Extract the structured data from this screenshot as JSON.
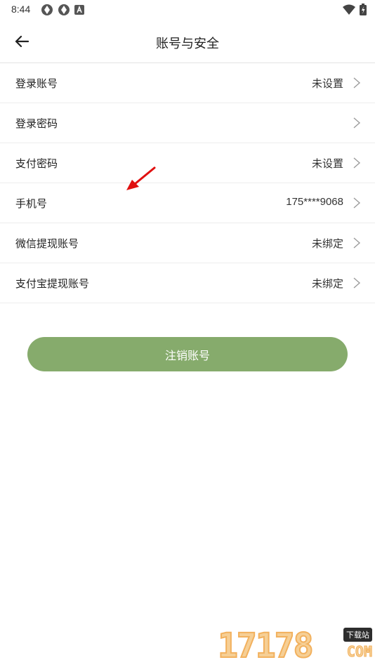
{
  "status_bar": {
    "time": "8:44"
  },
  "header": {
    "title": "账号与安全"
  },
  "rows": [
    {
      "label": "登录账号",
      "value": "未设置"
    },
    {
      "label": "登录密码",
      "value": ""
    },
    {
      "label": "支付密码",
      "value": "未设置"
    },
    {
      "label": "手机号",
      "value": "175****9068"
    },
    {
      "label": "微信提现账号",
      "value": "未绑定"
    },
    {
      "label": "支付宝提现账号",
      "value": "未绑定"
    }
  ],
  "deactivate_label": "注销账号",
  "watermark": {
    "digits": "17178",
    "tag": "下载站",
    "suffix": "COM"
  },
  "colors": {
    "accent": "#86ab6c",
    "annotation": "#e01010"
  }
}
